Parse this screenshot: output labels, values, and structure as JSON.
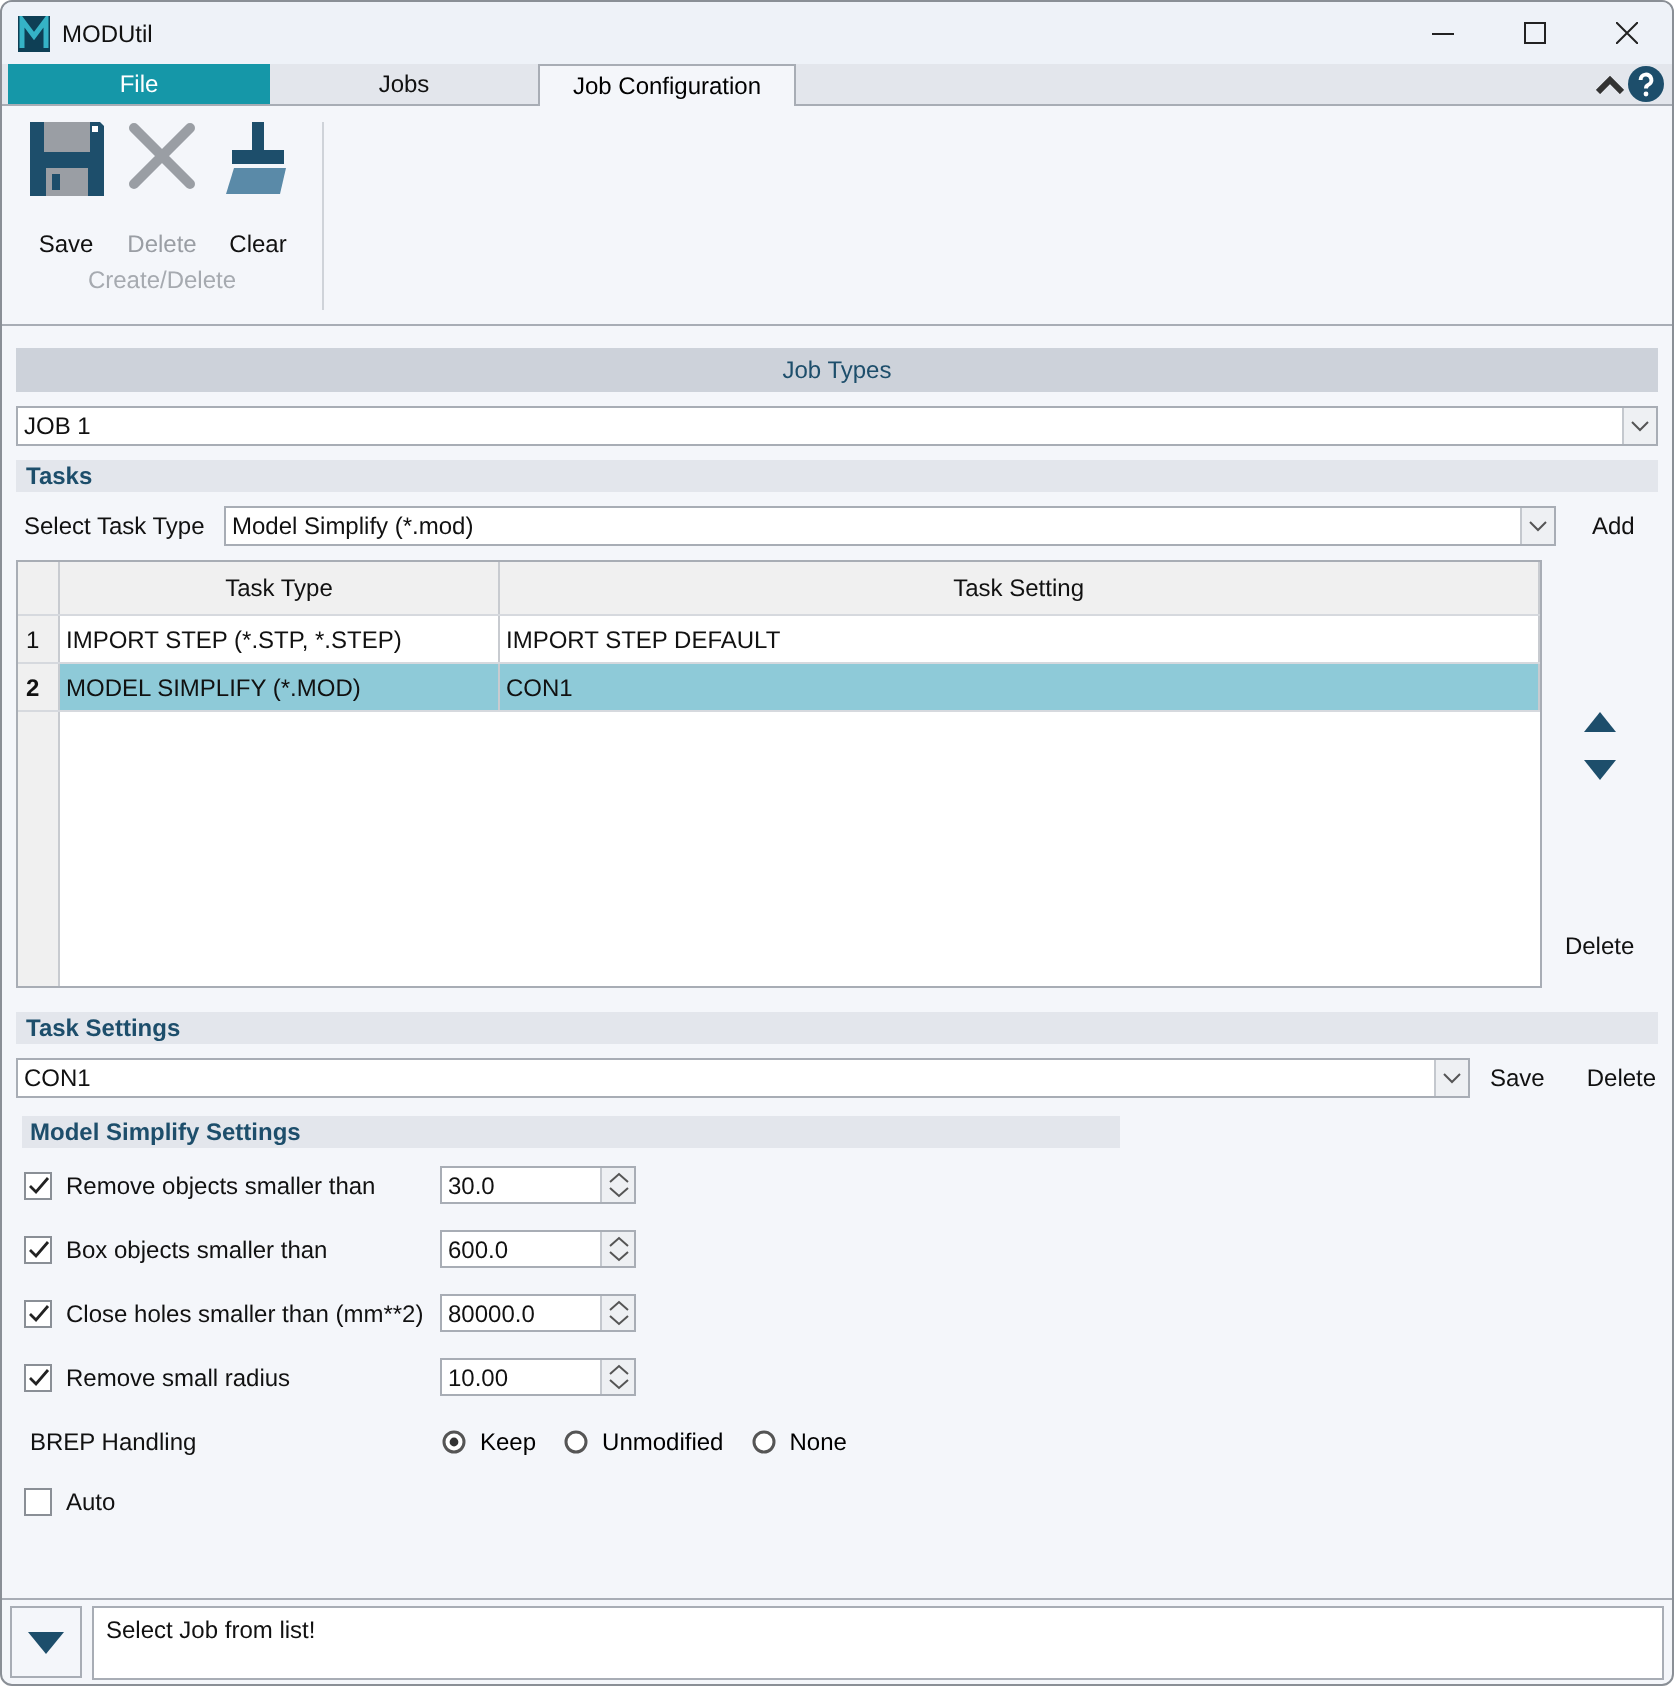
{
  "window": {
    "title": "MODUtil"
  },
  "tabs": [
    {
      "label": "File",
      "kind": "menu",
      "selected": false
    },
    {
      "label": "Jobs",
      "kind": "tab",
      "selected": false
    },
    {
      "label": "Job Configuration",
      "kind": "tab",
      "selected": true
    }
  ],
  "ribbon": {
    "buttons": [
      {
        "label": "Save",
        "disabled": false
      },
      {
        "label": "Delete",
        "disabled": true
      },
      {
        "label": "Clear",
        "disabled": false
      }
    ],
    "group_label": "Create/Delete"
  },
  "job_types": {
    "title": "Job Types",
    "value": "JOB 1"
  },
  "tasks": {
    "title": "Tasks",
    "select_label": "Select Task Type",
    "select_value": "Model Simplify (*.mod)",
    "add": "Add",
    "delete": "Delete",
    "columns": [
      "Task Type",
      "Task Setting"
    ],
    "rows": [
      {
        "number": "1",
        "task_type": "IMPORT STEP (*.STP, *.STEP)",
        "task_setting": "IMPORT STEP DEFAULT",
        "selected": false
      },
      {
        "number": "2",
        "task_type": "MODEL SIMPLIFY (*.MOD)",
        "task_setting": "CON1",
        "selected": true
      }
    ]
  },
  "task_settings": {
    "title": "Task Settings",
    "value": "CON1",
    "save": "Save",
    "delete": "Delete"
  },
  "model_simplify": {
    "title": "Model Simplify Settings",
    "settings": [
      {
        "label": "Remove objects smaller than",
        "value": "30.0",
        "checked": true
      },
      {
        "label": "Box objects smaller than",
        "value": "600.0",
        "checked": true
      },
      {
        "label": "Close holes smaller than (mm**2)",
        "value": "80000.0",
        "checked": true
      },
      {
        "label": "Remove small radius",
        "value": "10.00",
        "checked": true
      }
    ],
    "brep": {
      "label": "BREP Handling",
      "options": [
        {
          "label": "Keep",
          "selected": true
        },
        {
          "label": "Unmodified",
          "selected": false
        },
        {
          "label": "None",
          "selected": false
        }
      ]
    },
    "auto": {
      "label": "Auto",
      "checked": false
    }
  },
  "status": {
    "message": "Select Job from list!"
  }
}
